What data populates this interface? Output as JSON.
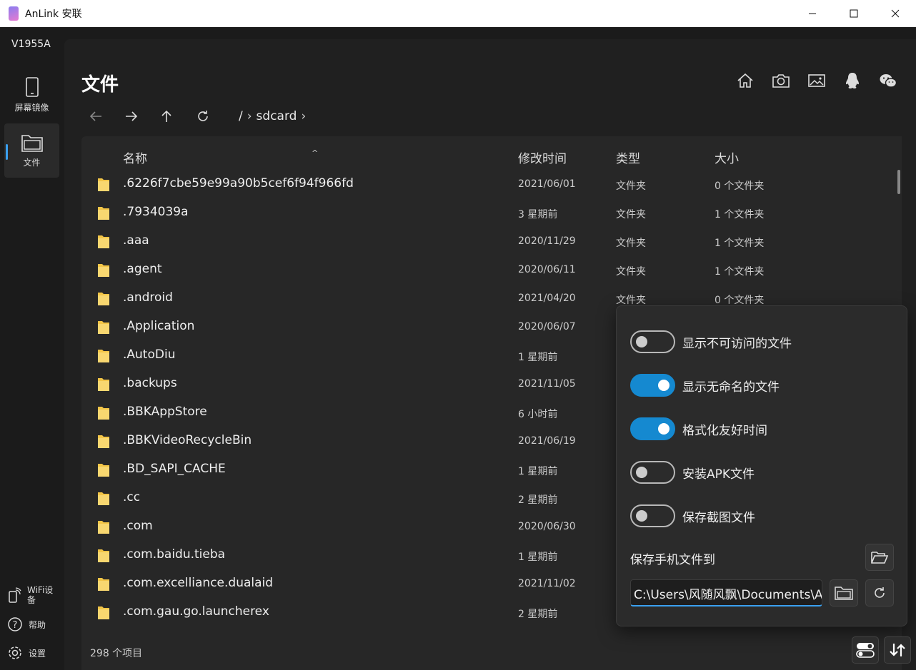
{
  "window": {
    "title": "AnLink 安联",
    "minimize": "—",
    "maximize": "☐",
    "close": "✕"
  },
  "sidebar": {
    "device": "V1955A",
    "items": [
      {
        "label": "屏幕镜像",
        "icon": "phone-icon"
      },
      {
        "label": "文件",
        "icon": "folder-icon",
        "selected": true
      }
    ],
    "bottom": [
      {
        "label": "WiFi设备",
        "icon": "wifi-phone-icon"
      },
      {
        "label": "帮助",
        "icon": "help-icon"
      },
      {
        "label": "设置",
        "icon": "gear-icon"
      }
    ]
  },
  "main": {
    "title": "文件",
    "top_icons": [
      "home-icon",
      "camera-icon",
      "image-icon",
      "qq-icon",
      "wechat-icon"
    ],
    "path": {
      "root": "/",
      "segments": [
        "sdcard"
      ]
    },
    "columns": {
      "name": "名称",
      "modified": "修改时间",
      "type": "类型",
      "size": "大小"
    },
    "rows": [
      {
        "name": ".6226f7cbe59e99a90b5cef6f94f966fd",
        "date": "2021/06/01",
        "type": "文件夹",
        "size": "0 个文件夹"
      },
      {
        "name": ".7934039a",
        "date": "3 星期前",
        "type": "文件夹",
        "size": "1 个文件夹"
      },
      {
        "name": ".aaa",
        "date": "2020/11/29",
        "type": "文件夹",
        "size": "1 个文件夹"
      },
      {
        "name": ".agent",
        "date": "2020/06/11",
        "type": "文件夹",
        "size": "1 个文件夹"
      },
      {
        "name": ".android",
        "date": "2021/04/20",
        "type": "文件夹",
        "size": "0 个文件夹"
      },
      {
        "name": ".Application",
        "date": "2020/06/07",
        "type": "",
        "size": ""
      },
      {
        "name": ".AutoDiu",
        "date": "1 星期前",
        "type": "",
        "size": ""
      },
      {
        "name": ".backups",
        "date": "2021/11/05",
        "type": "",
        "size": ""
      },
      {
        "name": ".BBKAppStore",
        "date": "6 小时前",
        "type": "",
        "size": ""
      },
      {
        "name": ".BBKVideoRecycleBin",
        "date": "2021/06/19",
        "type": "",
        "size": ""
      },
      {
        "name": ".BD_SAPI_CACHE",
        "date": "1 星期前",
        "type": "",
        "size": ""
      },
      {
        "name": ".cc",
        "date": "2 星期前",
        "type": "",
        "size": ""
      },
      {
        "name": ".com",
        "date": "2020/06/30",
        "type": "",
        "size": ""
      },
      {
        "name": ".com.baidu.tieba",
        "date": "1 星期前",
        "type": "",
        "size": ""
      },
      {
        "name": ".com.excelliance.dualaid",
        "date": "2021/11/02",
        "type": "",
        "size": ""
      },
      {
        "name": ".com.gau.go.launcherex",
        "date": "2 星期前",
        "type": "",
        "size": ""
      }
    ],
    "footer": "298 个项目"
  },
  "settings_panel": {
    "toggles": [
      {
        "label": "显示不可访问的文件",
        "on": false
      },
      {
        "label": "显示无命名的文件",
        "on": true
      },
      {
        "label": "格式化友好时间",
        "on": true
      },
      {
        "label": "安装APK文件",
        "on": false
      },
      {
        "label": "保存截图文件",
        "on": false
      }
    ],
    "save_label": "保存手机文件到",
    "save_path": "C:\\Users\\风随风飘\\Documents\\AnLink"
  },
  "colors": {
    "accent": "#1589d0",
    "folder": "#f3c547",
    "bg": "#202020"
  }
}
